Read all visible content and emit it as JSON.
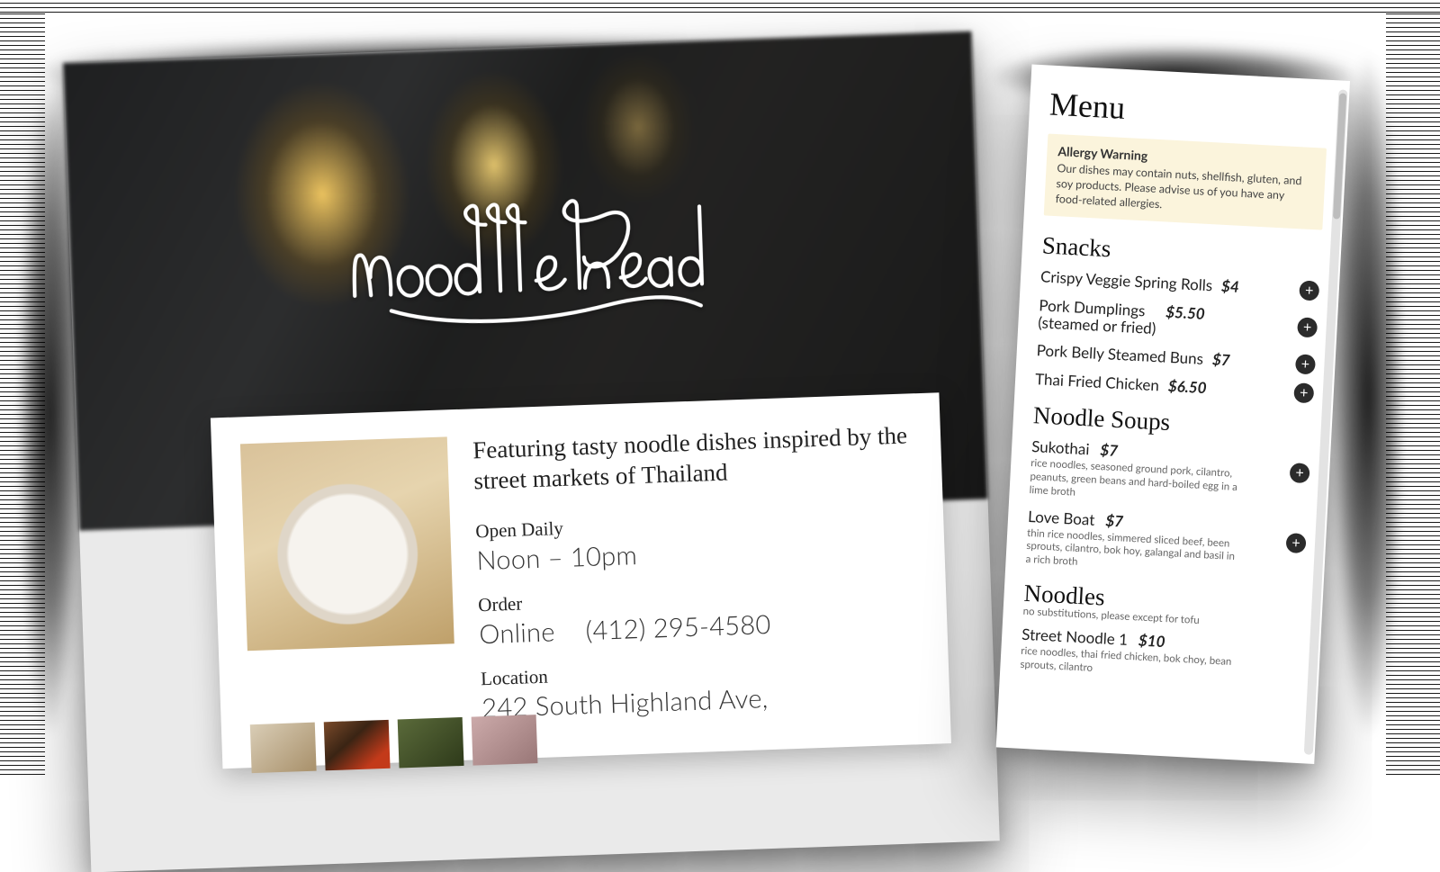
{
  "left": {
    "logo_text": "noodlehead",
    "tagline": "Featuring tasty noodle dishes inspired by the street markets of Thailand",
    "hours_label": "Open Daily",
    "hours_value": "Noon – 10pm",
    "order_label": "Order",
    "order_online": "Online",
    "order_phone": "(412) 295-4580",
    "location_label": "Location",
    "location_value": "242 South Highland Ave,"
  },
  "menu": {
    "title": "Menu",
    "allergy_title": "Allergy Warning",
    "allergy_text": "Our dishes may contain nuts, shellfish, gluten, and soy products. Please advise us of you have any food-related allergies.",
    "sections": [
      {
        "title": "Snacks",
        "items": [
          {
            "name": "Crispy Veggie Spring Rolls",
            "price": "$4"
          },
          {
            "name": "Pork Dumplings\n(steamed or fried)",
            "price": "$5.50"
          },
          {
            "name": "Pork Belly Steamed Buns",
            "price": "$7"
          },
          {
            "name": "Thai Fried Chicken",
            "price": "$6.50"
          }
        ]
      },
      {
        "title": "Noodle Soups",
        "items": [
          {
            "name": "Sukothai",
            "price": "$7",
            "desc": "rice noodles, seasoned ground pork, cilantro, peanuts, green beans and hard-boiled egg in a lime broth"
          },
          {
            "name": "Love Boat",
            "price": "$7",
            "desc": "thin rice noodles, simmered sliced beef, been sprouts, cilantro, bok hoy, galangal and basil in a rich broth"
          }
        ]
      },
      {
        "title": "Noodles",
        "subtitle": "no substitutions, please except for tofu",
        "items": [
          {
            "name": "Street Noodle 1",
            "price": "$10",
            "desc": "rice noodles, thai fried chicken, bok choy, bean sprouts, cilantro"
          }
        ]
      }
    ]
  }
}
